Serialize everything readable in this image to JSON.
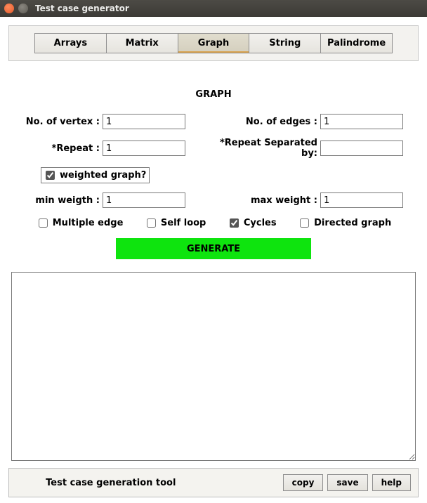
{
  "window": {
    "title": "Test case generator"
  },
  "tabs": {
    "items": [
      "Arrays",
      "Matrix",
      "Graph",
      "String",
      "Palindrome"
    ],
    "active_index": 2
  },
  "section": {
    "title": "GRAPH",
    "labels": {
      "vertex": "No. of vertex :",
      "edges": "No. of edges :",
      "repeat": "*Repeat :",
      "repeat_sep": "*Repeat Separated by:",
      "weighted": "weighted graph?",
      "min_w": "min weigth :",
      "max_w": "max weight :",
      "multi_edge": "Multiple edge",
      "self_loop": "Self loop",
      "cycles": "Cycles",
      "directed": "Directed graph"
    },
    "values": {
      "vertex": "1",
      "edges": "1",
      "repeat": "1",
      "repeat_sep": "",
      "min_w": "1",
      "max_w": "1"
    },
    "checks": {
      "weighted": true,
      "multi_edge": false,
      "self_loop": false,
      "cycles": true,
      "directed": false
    },
    "generate_label": "GENERATE"
  },
  "output": {
    "text": ""
  },
  "footer": {
    "text": "Test case generation tool",
    "buttons": {
      "copy": "copy",
      "save": "save",
      "help": "help"
    }
  }
}
